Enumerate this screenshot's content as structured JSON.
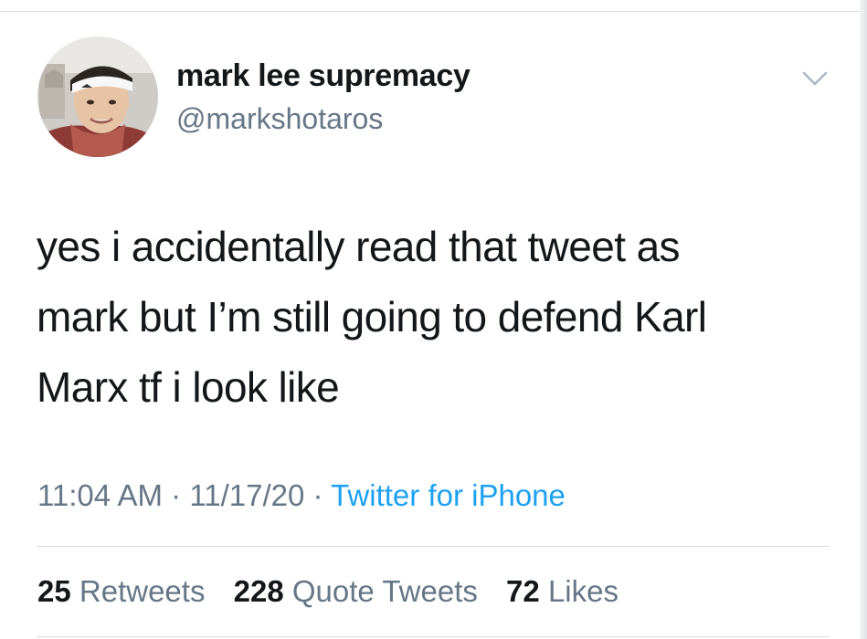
{
  "user": {
    "display_name": "mark lee supremacy",
    "handle": "@markshotaros"
  },
  "tweet": {
    "text_lines": [
      "yes i accidentally read that tweet as",
      "mark but I’m still going to defend Karl",
      "Marx tf i look like"
    ],
    "time": "11:04 AM",
    "date": "11/17/20",
    "separator": "·",
    "source": "Twitter for iPhone"
  },
  "stats": {
    "retweets": {
      "count": "25",
      "label": "Retweets"
    },
    "quote_tweets": {
      "count": "228",
      "label": "Quote Tweets"
    },
    "likes": {
      "count": "72",
      "label": "Likes"
    }
  },
  "icons": {
    "caret": "chevron-down-icon",
    "avatar": "profile-photo"
  },
  "colors": {
    "text": "#14171a",
    "secondary": "#657786",
    "link": "#1da1f2",
    "divider": "#d9dde1"
  }
}
